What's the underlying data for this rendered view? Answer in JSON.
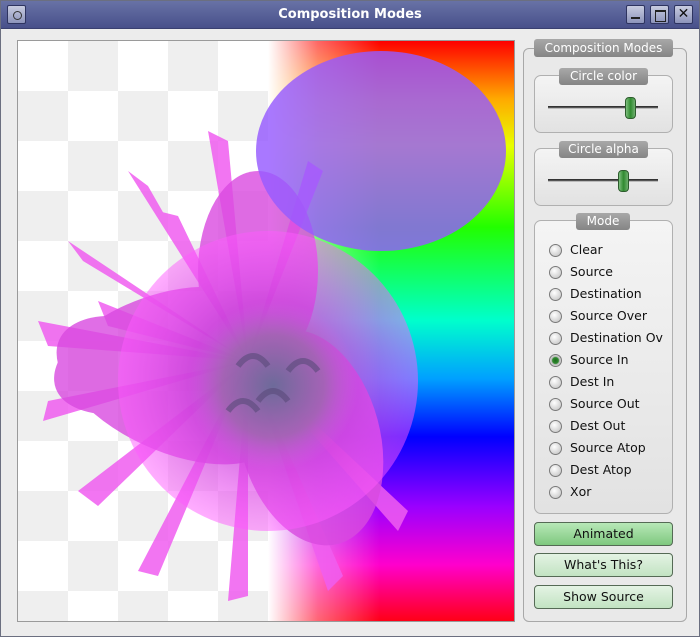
{
  "window": {
    "title": "Composition Modes"
  },
  "panel": {
    "title": "Composition Modes"
  },
  "circle_color": {
    "title": "Circle color",
    "value": 0.75
  },
  "circle_alpha": {
    "title": "Circle alpha",
    "value": 0.69
  },
  "mode": {
    "title": "Mode",
    "selected": "Source In",
    "options": [
      "Clear",
      "Source",
      "Destination",
      "Source Over",
      "Destination Ov",
      "Source In",
      "Dest In",
      "Source Out",
      "Dest Out",
      "Source Atop",
      "Dest Atop",
      "Xor"
    ]
  },
  "buttons": {
    "animated": "Animated",
    "whats_this": "What's This?",
    "show_source": "Show Source"
  },
  "colors": {
    "accent_green": "#2f8a2f",
    "circle": "#9a5aff",
    "titlebar": "#5a62a0"
  }
}
